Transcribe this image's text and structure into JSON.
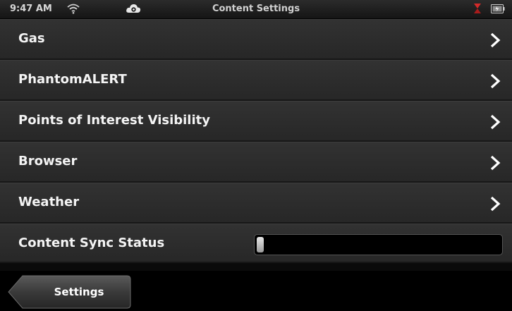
{
  "status_bar": {
    "time": "9:47 AM",
    "title": "Content Settings",
    "icons": [
      "wifi-icon",
      "cloud-sync-icon",
      "alert-icon",
      "battery-icon"
    ]
  },
  "menu": {
    "items": [
      {
        "label": "Gas"
      },
      {
        "label": "PhantomALERT"
      },
      {
        "label": "Points of Interest Visibility"
      },
      {
        "label": "Browser"
      },
      {
        "label": "Weather"
      }
    ]
  },
  "sync": {
    "label": "Content Sync Status",
    "progress_percent": 3
  },
  "footer": {
    "back_label": "Settings"
  },
  "colors": {
    "row_background": "#2d2d2d",
    "alert_red": "#d42a2a",
    "footer_background": "#000000"
  }
}
